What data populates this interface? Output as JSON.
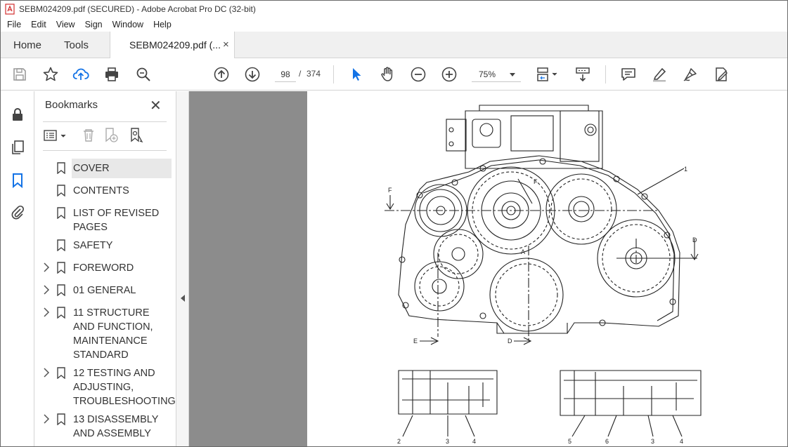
{
  "window": {
    "title": "SEBM024209.pdf (SECURED) - Adobe Acrobat Pro DC (32-bit)"
  },
  "menu": [
    "File",
    "Edit",
    "View",
    "Sign",
    "Window",
    "Help"
  ],
  "tabs": {
    "home": "Home",
    "tools": "Tools",
    "doc": "SEBM024209.pdf (...",
    "close": "×"
  },
  "toolbar": {
    "page_current": "98",
    "page_sep": "/",
    "page_total": "374",
    "zoom": "75%"
  },
  "bookmarks": {
    "title": "Bookmarks",
    "close": "✕",
    "items": [
      {
        "label": "COVER",
        "expandable": false
      },
      {
        "label": "CONTENTS",
        "expandable": false
      },
      {
        "label": "LIST OF REVISED PAGES",
        "expandable": false
      },
      {
        "label": "SAFETY",
        "expandable": false
      },
      {
        "label": "FOREWORD",
        "expandable": true
      },
      {
        "label": "01 GENERAL",
        "expandable": true
      },
      {
        "label": "11 STRUCTURE AND FUNCTION, MAINTENANCE STANDARD",
        "expandable": true
      },
      {
        "label": "12 TESTING AND ADJUSTING, TROUBLESHOOTING",
        "expandable": true
      },
      {
        "label": "13 DISASSEMBLY AND ASSEMBLY",
        "expandable": true
      }
    ]
  },
  "drawing": {
    "labels": {
      "one": "1",
      "f": "F",
      "d": "D",
      "e": "E",
      "a": "A",
      "n2": "2",
      "n3": "3",
      "n4": "4",
      "n5": "5",
      "n6": "6"
    }
  },
  "colors": {
    "accent_blue": "#1473e6",
    "selected_bg": "#e8e8e8",
    "doc_bg": "#8c8c8c"
  }
}
